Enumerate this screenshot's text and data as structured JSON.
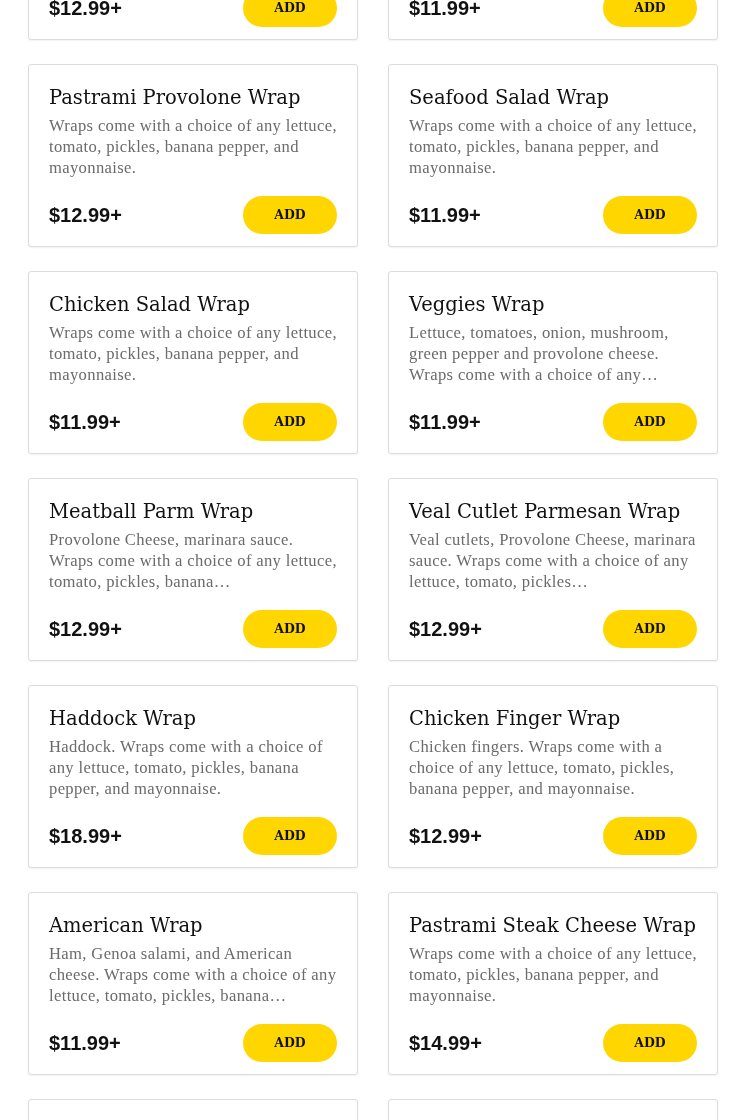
{
  "partial_cards": [
    {
      "price": "$12.99+",
      "button": "ADD"
    },
    {
      "price": "$11.99+",
      "button": "ADD"
    }
  ],
  "items": [
    {
      "name": "Pastrami Provolone Wrap",
      "description": "Wraps come with a choice of any lettuce, tomato, pickles, banana pepper, and mayonnaise.",
      "price": "$12.99+",
      "button": "ADD"
    },
    {
      "name": "Seafood Salad Wrap",
      "description": "Wraps come with a choice of any lettuce, tomato, pickles, banana pepper, and mayonnaise.",
      "price": "$11.99+",
      "button": "ADD"
    },
    {
      "name": "Chicken Salad Wrap",
      "description": "Wraps come with a choice of any lettuce, tomato, pickles, banana pepper, and mayonnaise.",
      "price": "$11.99+",
      "button": "ADD"
    },
    {
      "name": "Veggies Wrap",
      "description": "Lettuce, tomatoes, onion, mushroom, green pepper and provolone cheese. Wraps come with a choice of any…",
      "price": "$11.99+",
      "button": "ADD"
    },
    {
      "name": "Meatball Parm Wrap",
      "description": "Provolone Cheese, marinara sauce. Wraps come with a choice of any lettuce, tomato, pickles, banana…",
      "price": "$12.99+",
      "button": "ADD"
    },
    {
      "name": "Veal Cutlet Parmesan Wrap",
      "description": "Veal cutlets, Provolone Cheese, marinara sauce. Wraps come with a choice of any lettuce, tomato, pickles…",
      "price": "$12.99+",
      "button": "ADD"
    },
    {
      "name": "Haddock Wrap",
      "description": "Haddock. Wraps come with a choice of any lettuce, tomato, pickles, banana pepper, and mayonnaise.",
      "price": "$18.99+",
      "button": "ADD"
    },
    {
      "name": "Chicken Finger Wrap",
      "description": "Chicken fingers. Wraps come with a choice of any lettuce, tomato, pickles, banana pepper, and mayonnaise.",
      "price": "$12.99+",
      "button": "ADD"
    },
    {
      "name": "American Wrap",
      "description": "Ham, Genoa salami, and American cheese. Wraps come with a choice of any lettuce, tomato, pickles, banana…",
      "price": "$11.99+",
      "button": "ADD"
    },
    {
      "name": "Pastrami Steak Cheese Wrap",
      "description": "Wraps come with a choice of any lettuce, tomato, pickles, banana pepper, and mayonnaise.",
      "price": "$14.99+",
      "button": "ADD"
    }
  ]
}
